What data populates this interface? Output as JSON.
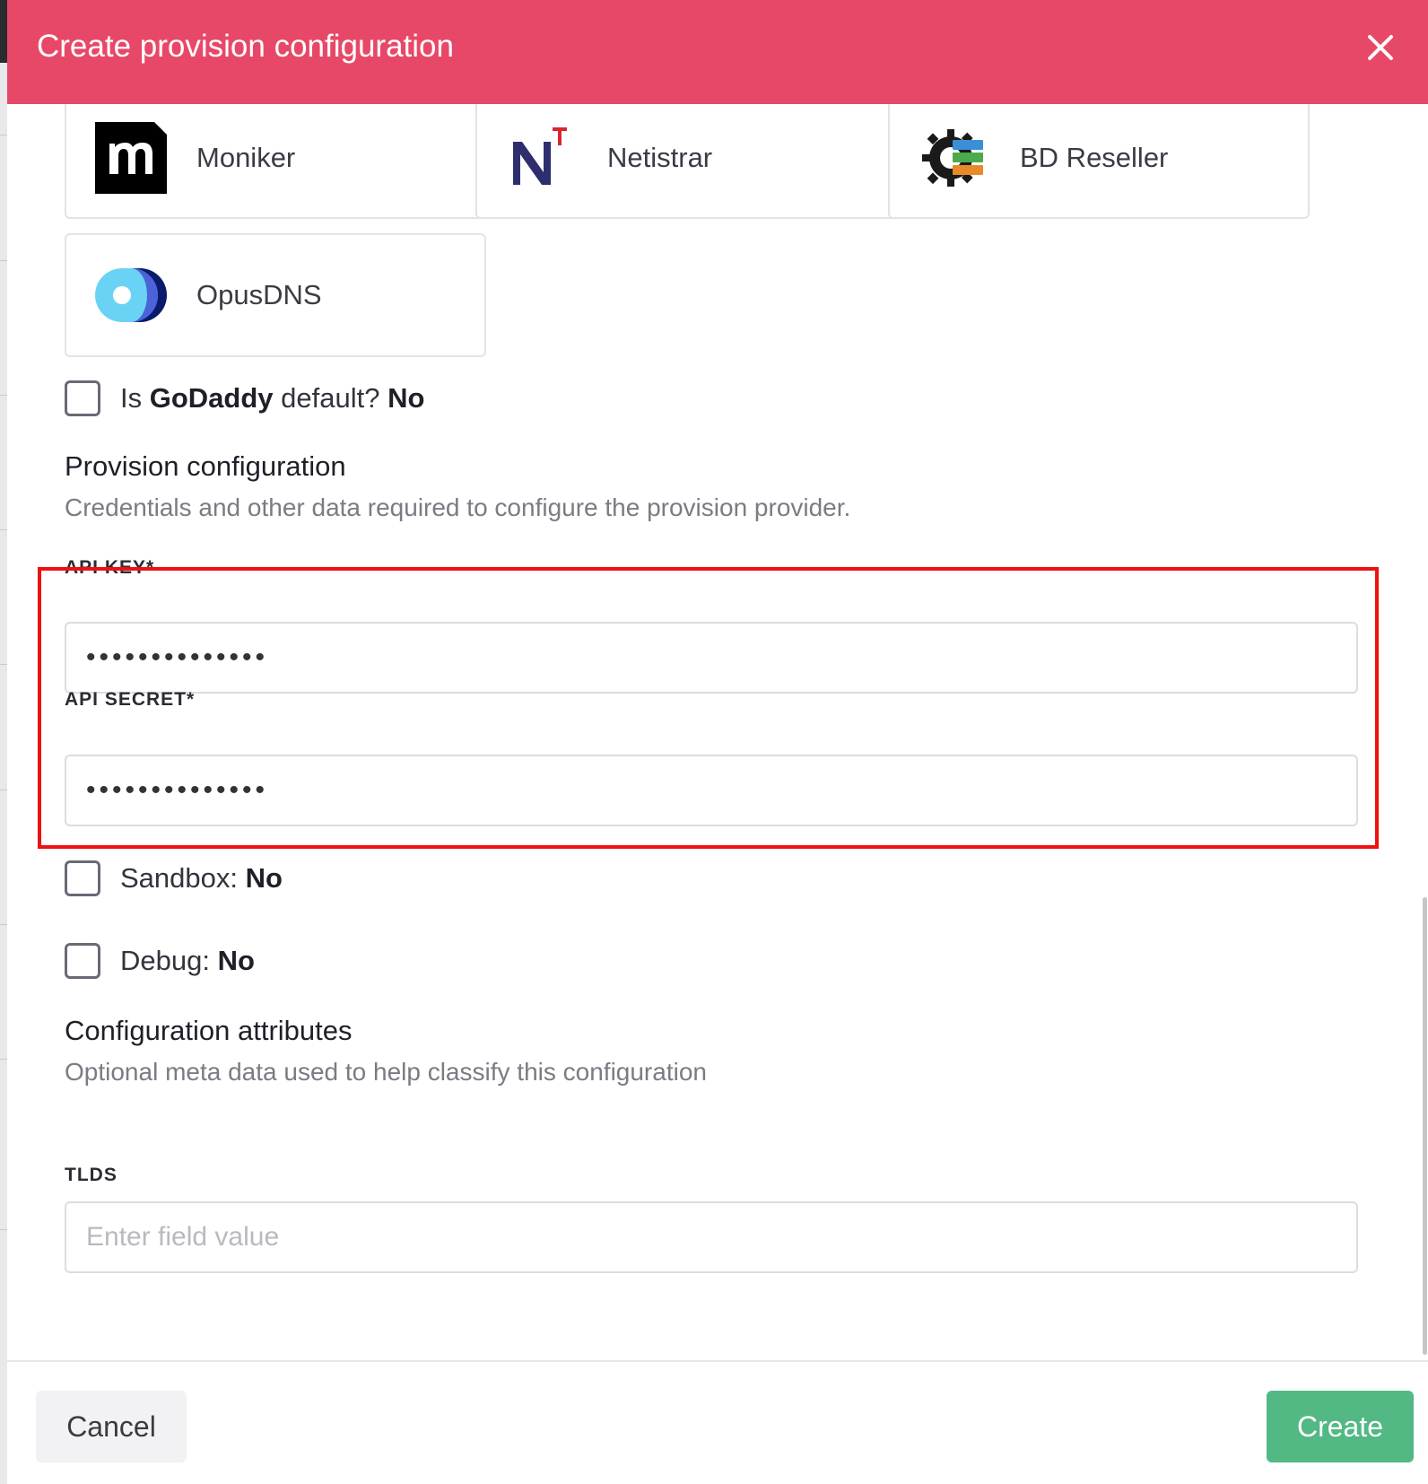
{
  "modal": {
    "title": "Create provision configuration",
    "close_icon": "close-icon"
  },
  "providers": [
    {
      "name": "Moniker",
      "icon": "moniker-logo-icon"
    },
    {
      "name": "Netistrar",
      "icon": "netistrar-logo-icon"
    },
    {
      "name": "BD Reseller",
      "icon": "bd-reseller-logo-icon"
    },
    {
      "name": "OpusDNS",
      "icon": "opusdns-logo-icon"
    }
  ],
  "default_checkbox": {
    "prefix": "Is",
    "provider": "GoDaddy",
    "suffix": "default?",
    "value": "No",
    "checked": false
  },
  "provision_section": {
    "title": "Provision configuration",
    "description": "Credentials and other data required to configure the provision provider."
  },
  "fields": {
    "api_key": {
      "label": "API KEY*",
      "value": "••••••••••••••"
    },
    "api_secret": {
      "label": "API SECRET*",
      "value": "••••••••••••••"
    }
  },
  "sandbox": {
    "label": "Sandbox:",
    "value": "No",
    "checked": false
  },
  "debug": {
    "label": "Debug:",
    "value": "No",
    "checked": false
  },
  "attributes_section": {
    "title": "Configuration attributes",
    "description": "Optional meta data used to help classify this configuration"
  },
  "tlds": {
    "label": "TLDS",
    "placeholder": "Enter field value",
    "value": ""
  },
  "footer": {
    "cancel_label": "Cancel",
    "create_label": "Create"
  },
  "colors": {
    "header": "#e84868",
    "create_button": "#52b884",
    "highlight": "#ee1111"
  }
}
